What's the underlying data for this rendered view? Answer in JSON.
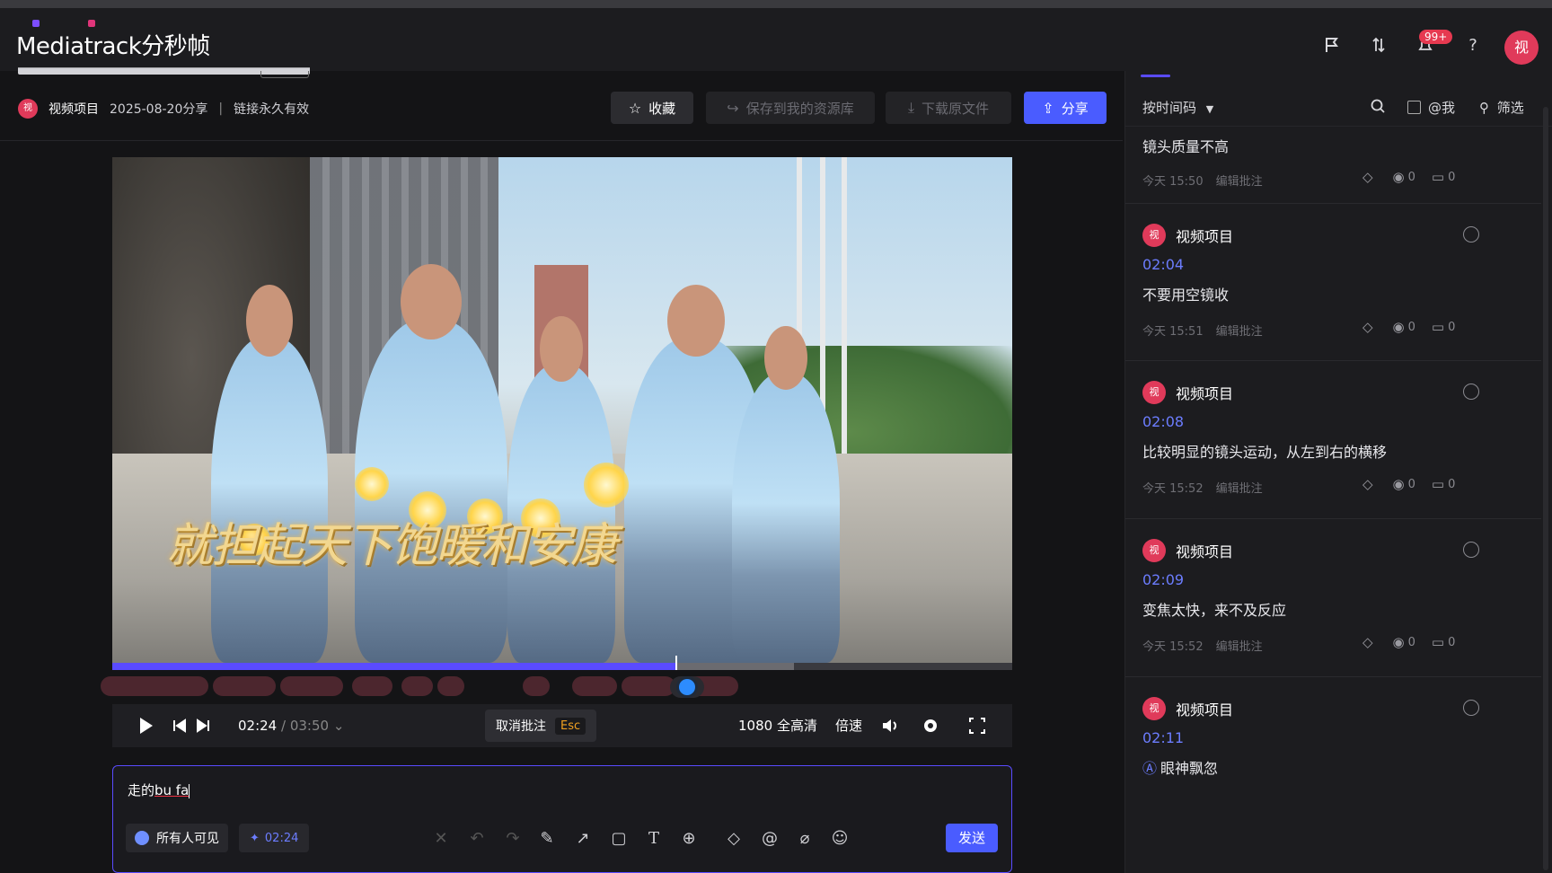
{
  "brand": {
    "logo": "Mediatrack分秒帧"
  },
  "topbar": {
    "icons": [
      "flag-icon",
      "transfer-icon",
      "bell-icon",
      "help-icon"
    ],
    "notif_badge": "99+",
    "help": "?",
    "avatar": "视"
  },
  "share": {
    "project_avatar": "视",
    "project_name": "视频项目",
    "shared_on": "2025-08-20分享",
    "separator": "|",
    "link_note": "链接永久有效",
    "buttons": {
      "favorite": "收藏",
      "save_to_library": "保存到我的资源库",
      "download": "下载原文件",
      "share": "分享"
    }
  },
  "player": {
    "subtitle": "就担起天下饱暖和安康",
    "current_time": "02:24",
    "duration": "/ 03:50",
    "progress_fraction": 0.627,
    "buffered_fraction": 0.757,
    "cancel_annotation": "取消批注",
    "esc": "Esc",
    "quality": "1080 全高清",
    "speed": "倍速"
  },
  "composer": {
    "text_prefix": "走的",
    "text_ime": "bu fa",
    "visibility": "所有人可见",
    "timestamp": "02:24",
    "send": "发送"
  },
  "panel": {
    "sort": "按时间码",
    "at_me": "@我",
    "filter": "筛选",
    "comments": [
      {
        "text": "镜头质量不高",
        "time": "今天 15:50",
        "edit": "编辑批注",
        "views": "0",
        "replies": "0"
      },
      {
        "author": "视频项目",
        "avatar": "视",
        "timecode": "02:04",
        "text": "不要用空镜收",
        "time": "今天 15:51",
        "edit": "编辑批注",
        "views": "0",
        "replies": "0"
      },
      {
        "author": "视频项目",
        "avatar": "视",
        "timecode": "02:08",
        "text": "比较明显的镜头运动，从左到右的横移",
        "time": "今天 15:52",
        "edit": "编辑批注",
        "views": "0",
        "replies": "0"
      },
      {
        "author": "视频项目",
        "avatar": "视",
        "timecode": "02:09",
        "text": "变焦太快，来不及反应",
        "time": "今天 15:52",
        "edit": "编辑批注",
        "views": "0",
        "replies": "0"
      },
      {
        "author": "视频项目",
        "avatar": "视",
        "timecode": "02:11",
        "text": "眼神飘忽"
      }
    ]
  },
  "colors": {
    "accent": "#4a5cff",
    "timecode": "#6c7dff",
    "avatar": "#e03a5a",
    "badge": "#e63950"
  }
}
